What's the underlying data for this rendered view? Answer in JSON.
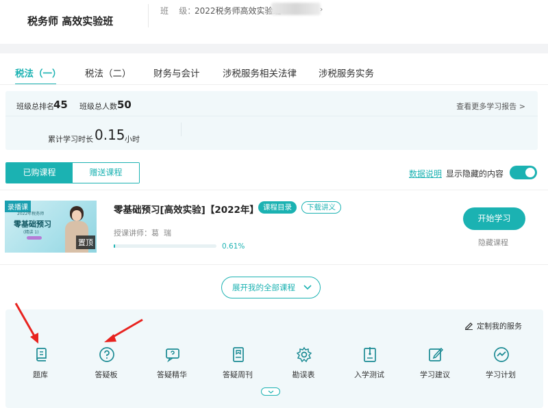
{
  "header": {
    "brand": "税务师 高效实验班",
    "class_label": "班    级：",
    "class_value": "2022税务师高效实验班",
    "chevron": "›"
  },
  "tabs": [
    {
      "label": "税法（一）",
      "active": true
    },
    {
      "label": "税法（二）",
      "active": false
    },
    {
      "label": "财务与会计",
      "active": false
    },
    {
      "label": "涉税服务相关法律",
      "active": false
    },
    {
      "label": "涉税服务实务",
      "active": false
    }
  ],
  "stats": {
    "rank_label": "班级总排名",
    "rank_value": "45",
    "total_label": "班级总人数",
    "total_value": "50",
    "report_link": "查看更多学习报告 >",
    "hours_label": "累计学习时长",
    "hours_value": "0.15",
    "hours_unit": "小时"
  },
  "course_toggle": {
    "purchased": "已购课程",
    "gifted": "赠送课程",
    "data_note": "数据说明",
    "show_hidden": "显示隐藏的内容",
    "show_hidden_on": true
  },
  "course": {
    "thumb_tag": "录播课",
    "thumb_sub": "2022年税务师",
    "thumb_title": "零基础预习",
    "thumb_mini": "(精讲 1)",
    "pin": "置顶",
    "title": "零基础预习[高效实验]【2022年】",
    "catalog": "课程目录",
    "download": "下载讲义",
    "teacher_label": "授课讲师：",
    "teacher_name": "葛  瑞",
    "progress_text": "0.61%",
    "progress_fraction": 0.0061,
    "start": "开始学习",
    "hide": "隐藏课程"
  },
  "expand_all": "展开我的全部课程",
  "services": {
    "custom": "定制我的服务",
    "items": [
      {
        "label": "题库",
        "icon": "question-bank-icon"
      },
      {
        "label": "答疑板",
        "icon": "qa-board-icon"
      },
      {
        "label": "答疑精华",
        "icon": "qa-highlights-icon"
      },
      {
        "label": "答疑周刊",
        "icon": "qa-weekly-icon"
      },
      {
        "label": "勘误表",
        "icon": "errata-icon"
      },
      {
        "label": "入学测试",
        "icon": "entrance-test-icon"
      },
      {
        "label": "学习建议",
        "icon": "study-advice-icon"
      },
      {
        "label": "学习计划",
        "icon": "study-plan-icon"
      }
    ]
  },
  "colors": {
    "accent": "#1bb2b2",
    "panel": "#f1f8fa",
    "arrow": "#e8231f"
  }
}
